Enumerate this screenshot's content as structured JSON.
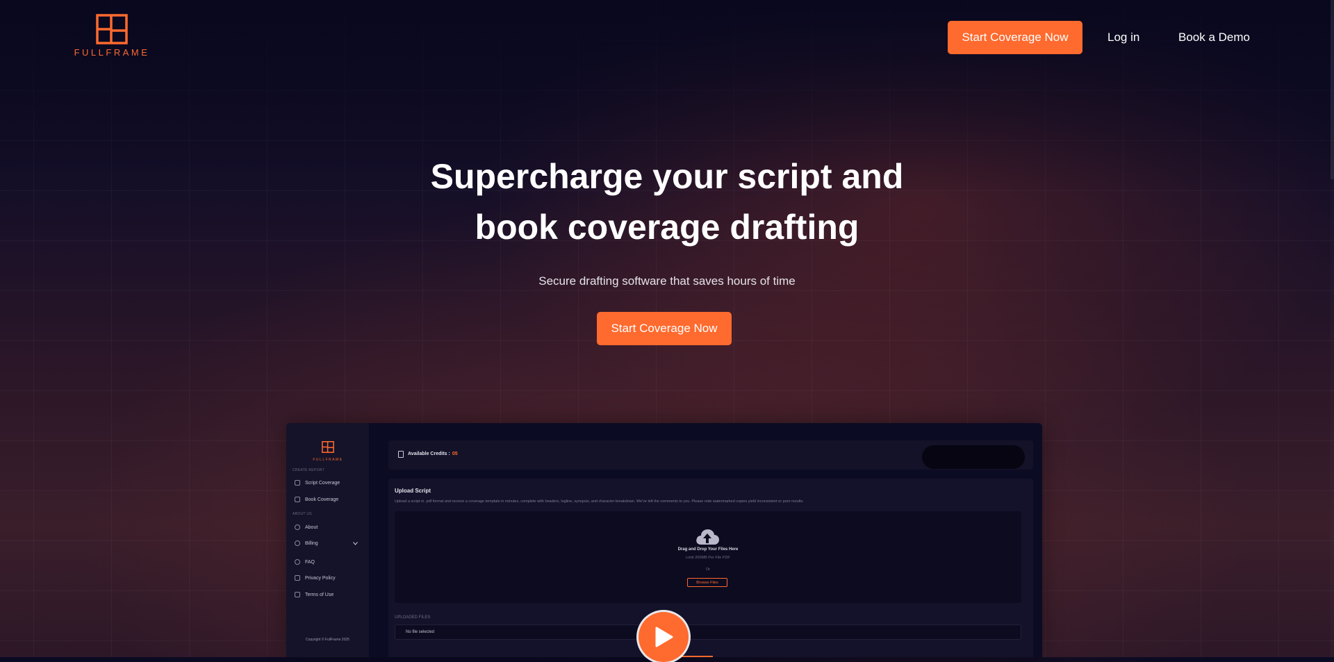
{
  "brand": {
    "name": "FULLFRAME",
    "accent_color": "#ff6a2e"
  },
  "nav": {
    "cta_label": "Start Coverage Now",
    "login_label": "Log in",
    "demo_label": "Book a Demo"
  },
  "hero": {
    "title_line1": "Supercharge your script and",
    "title_line2": "book coverage drafting",
    "subtitle": "Secure drafting software that saves hours of time",
    "cta_label": "Start Coverage Now"
  },
  "preview": {
    "brand": "FULLFRAME",
    "sections": {
      "create": "CREATE REPORT",
      "about": "ABOUT US"
    },
    "menu": [
      {
        "label": "Script Coverage",
        "icon": "script-icon"
      },
      {
        "label": "Book Coverage",
        "icon": "book-icon"
      },
      {
        "label": "About",
        "icon": "info-icon"
      },
      {
        "label": "Billing",
        "icon": "billing-icon"
      },
      {
        "label": "FAQ",
        "icon": "help-icon"
      },
      {
        "label": "Privacy Policy",
        "icon": "document-icon"
      },
      {
        "label": "Terms of Use",
        "icon": "terms-icon"
      }
    ],
    "copyright": "Copyright © FullFrame 2025",
    "credits_label": "Available Credits :",
    "credits_value": "05",
    "upload_title": "Upload Script",
    "upload_desc": "Upload a script in .pdf format and receive a coverage template in minutes, complete with headers, logline, synopsis, and character breakdown. We've left the comments to you. Please note watermarked copies yield inconsistent or poor results.",
    "drop_title": "Drag and Drop Your Files Here",
    "drop_limit": "Limit 200MB Per File PDF",
    "drop_or": "Or",
    "browse_label": "Browse Files",
    "uploaded_label": "UPLOADED FILES",
    "file_placeholder": "No file selected"
  },
  "icons": {
    "play": "play-icon",
    "upload": "cloud-upload-icon",
    "chevron": "chevron-down-icon"
  }
}
